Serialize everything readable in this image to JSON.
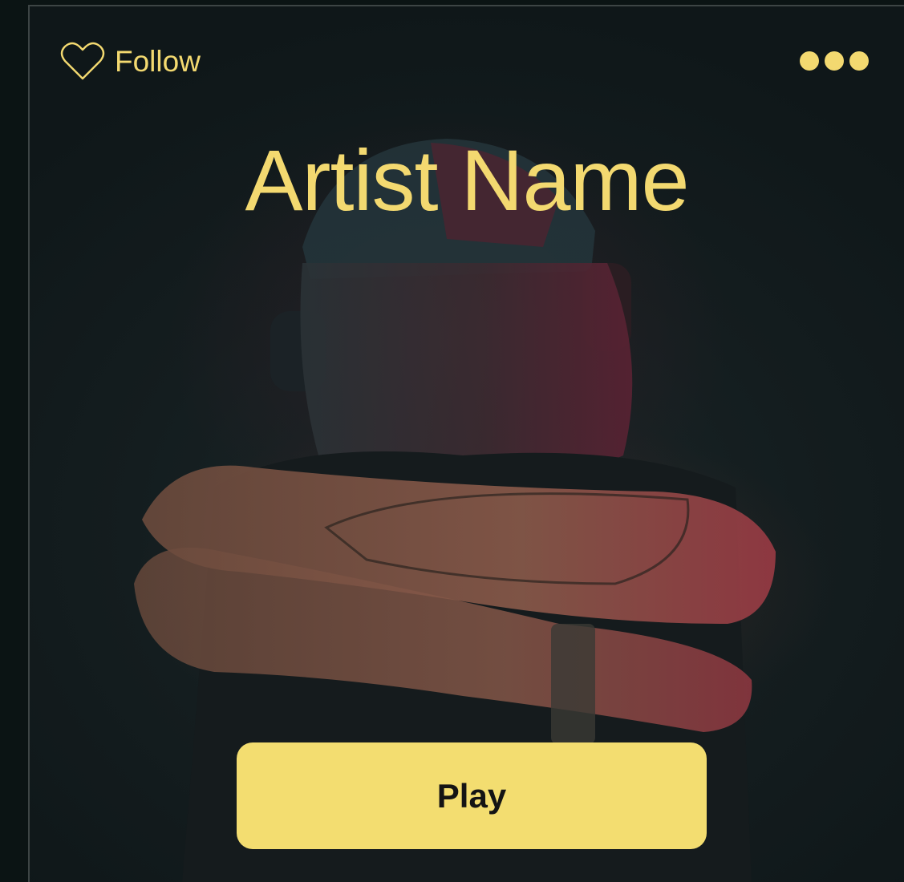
{
  "header": {
    "follow_label": "Follow",
    "follow_icon": "heart-outline-icon",
    "more_icon": "more-horizontal-icon"
  },
  "artist": {
    "name": "Artist Name"
  },
  "actions": {
    "play_label": "Play"
  },
  "colors": {
    "accent": "#f3d970",
    "button_bg": "#f3dd70",
    "button_text": "#141414",
    "background": "#141d1f"
  }
}
